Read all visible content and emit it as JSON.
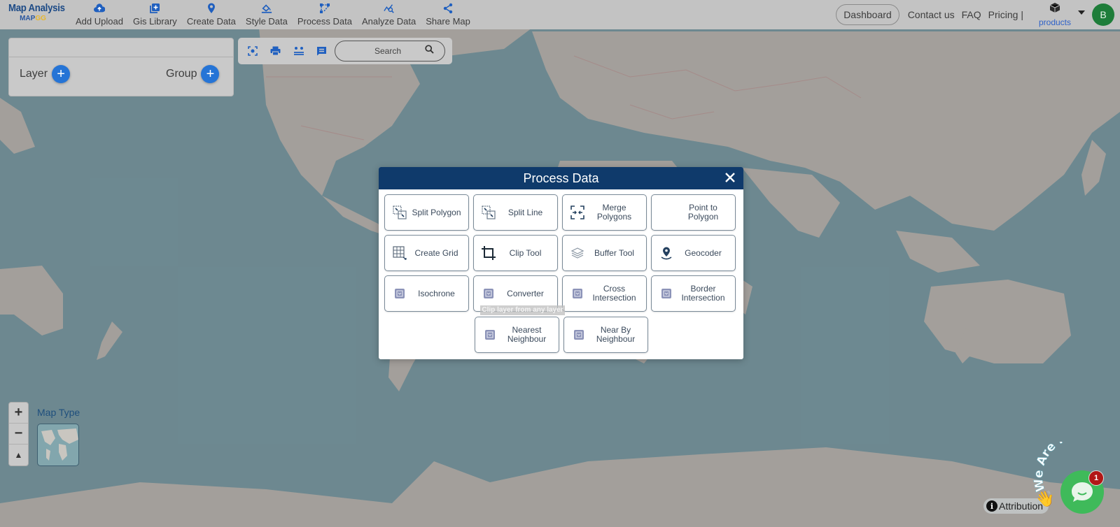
{
  "brand": {
    "title": "Map Analysis",
    "sub_main": "MAP",
    "sub_accent": "GG"
  },
  "nav": [
    {
      "label": "Add Upload",
      "icon": "cloud-upload-icon"
    },
    {
      "label": "Gis Library",
      "icon": "library-icon"
    },
    {
      "label": "Create Data",
      "icon": "map-pin-icon"
    },
    {
      "label": "Style Data",
      "icon": "paint-bucket-icon"
    },
    {
      "label": "Process Data",
      "icon": "process-nodes-icon"
    },
    {
      "label": "Analyze Data",
      "icon": "analyze-chart-icon"
    },
    {
      "label": "Share Map",
      "icon": "share-icon"
    }
  ],
  "right_nav": {
    "dashboard": "Dashboard",
    "contact": "Contact us",
    "faq": "FAQ",
    "pricing": "Pricing |",
    "products": "products",
    "avatar_initial": "B"
  },
  "layer_panel": {
    "layer_label": "Layer",
    "group_label": "Group",
    "add_symbol": "+"
  },
  "toolbar": {
    "search_placeholder": "Search"
  },
  "map_controls": {
    "zoom_in": "+",
    "zoom_out": "−",
    "compass": "▲",
    "map_type_label": "Map Type"
  },
  "modal": {
    "title": "Process Data",
    "close_symbol": "✕",
    "tools": [
      {
        "label": "Split Polygon",
        "icon": "split-polygon-icon"
      },
      {
        "label": "Split Line",
        "icon": "split-line-icon"
      },
      {
        "label": "Merge Polygons",
        "icon": "merge-polygons-icon"
      },
      {
        "label": "Point to Polygon",
        "icon": ""
      },
      {
        "label": "Create Grid",
        "icon": "grid-icon"
      },
      {
        "label": "Clip Tool",
        "icon": "crop-icon"
      },
      {
        "label": "Buffer Tool",
        "icon": "layers-icon"
      },
      {
        "label": "Geocoder",
        "icon": "location-pin-icon"
      },
      {
        "label": "Isochrone",
        "icon": "tool-glyph-icon"
      },
      {
        "label": "Converter",
        "icon": "tool-glyph-icon"
      },
      {
        "label": "Cross Intersection",
        "icon": "tool-glyph-icon"
      },
      {
        "label": "Border Intersection",
        "icon": "tool-glyph-icon"
      },
      {
        "label": "Nearest Neighbour",
        "icon": "tool-glyph-icon"
      },
      {
        "label": "Near By Neighbour",
        "icon": "tool-glyph-icon"
      }
    ],
    "tooltip": "Clip layer from any layer"
  },
  "attribution": {
    "label": "Attribution",
    "info_symbol": "i"
  },
  "chat": {
    "banner": "We Are Here!",
    "badge_count": "1"
  }
}
